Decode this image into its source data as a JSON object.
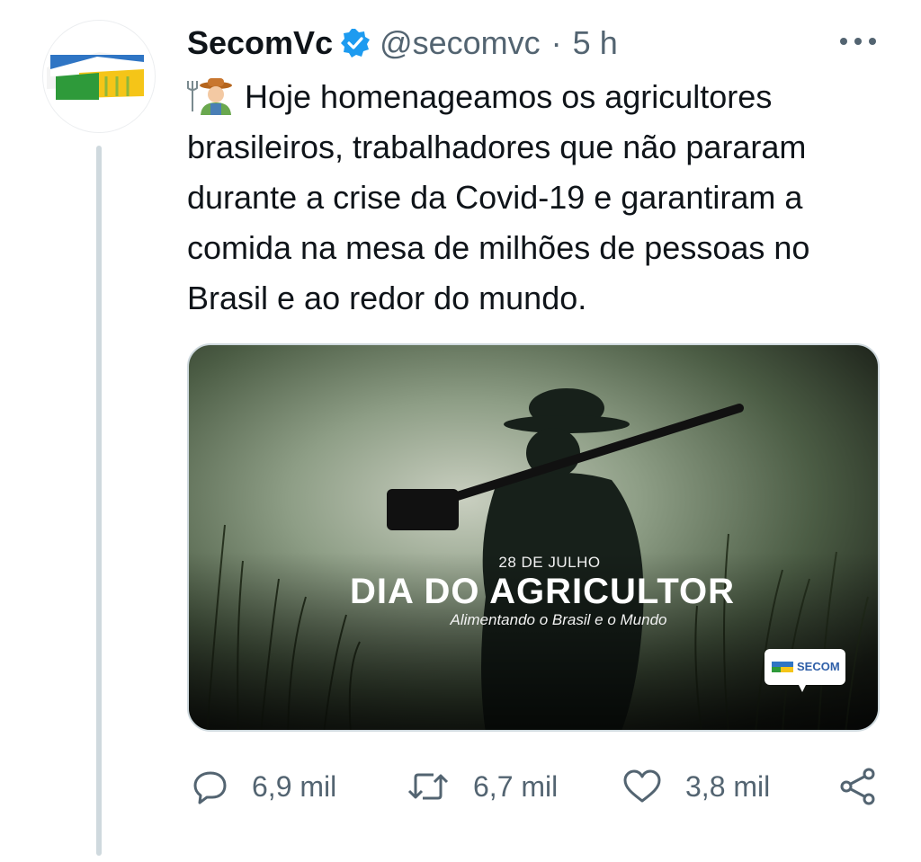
{
  "tweet": {
    "author_name": "SecomVc",
    "handle": "@secomvc",
    "separator": "·",
    "time": "5 h",
    "text": "Hoje homenageamos os agricultores brasileiros, trabalhadores que não pararam durante a crise da Covid-19 e garantiram a comida na mesa de milhões de pessoas no Brasil e ao redor do mundo.",
    "emoji": "farmer-emoji"
  },
  "media": {
    "date": "28 DE JULHO",
    "title": "DIA DO AGRICULTOR",
    "subtitle": "Alimentando o Brasil e o Mundo",
    "badge": "SECOM"
  },
  "actions": {
    "replies": "6,9 mil",
    "retweets": "6,7 mil",
    "likes": "3,8 mil"
  },
  "icons": [
    "reply-icon",
    "retweet-icon",
    "like-icon",
    "share-icon",
    "more-icon",
    "verified-icon"
  ],
  "colors": {
    "verified": "#1d9bf0",
    "secondary_text": "#536471",
    "thread_line": "#cfd9de"
  }
}
